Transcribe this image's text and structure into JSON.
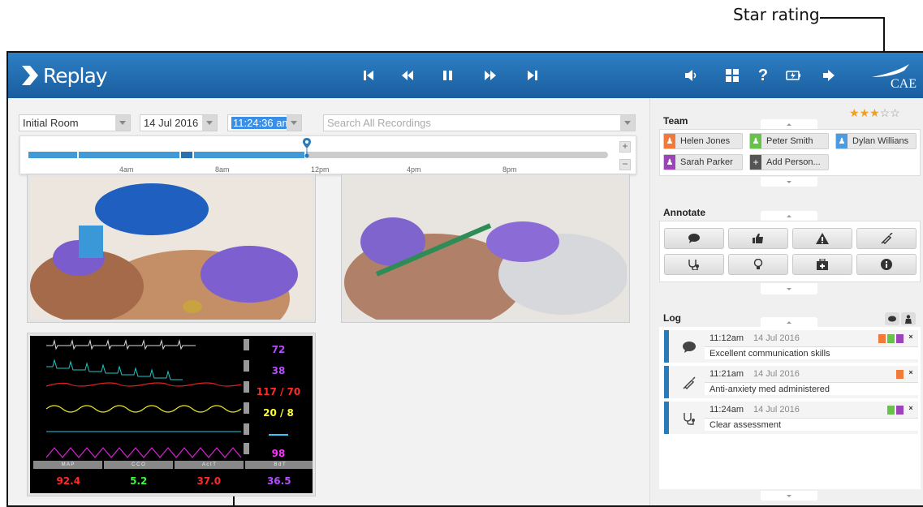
{
  "callout": {
    "star_rating": "Star rating"
  },
  "app": {
    "title": "Replay",
    "brand": "CAE",
    "accent": "#1f6fb2"
  },
  "filters": {
    "room": "Initial Room",
    "date": "14 Jul 2016",
    "time": "11:24:36 am",
    "search_placeholder": "Search All Recordings"
  },
  "timeline": {
    "ticks": [
      "4am",
      "8am",
      "12pm",
      "4pm",
      "8pm"
    ],
    "position_fraction": 0.48,
    "zoom_in": "+",
    "zoom_out": "−"
  },
  "monitor": {
    "values": [
      "72",
      "38",
      "117 / 70",
      "20 / 8",
      "",
      "98"
    ],
    "value_colors": [
      "#b44cff",
      "#b44cff",
      "#ff2a2a",
      "#ffff33",
      "#33c8ff",
      "#ff33ff"
    ],
    "labels": [
      "M A P",
      "C C O",
      "A c t T",
      "B d T"
    ],
    "bottom": [
      "92.4",
      "5.2",
      "37.0",
      "36.5"
    ],
    "bottom_colors": [
      "#ff2a2a",
      "#33ff33",
      "#ff2a2a",
      "#b44cff"
    ]
  },
  "rating": {
    "value": 3,
    "max": 5
  },
  "team": {
    "heading": "Team",
    "members": [
      {
        "name": "Helen Jones",
        "color": "#f07a3a"
      },
      {
        "name": "Peter Smith",
        "color": "#68c24a"
      },
      {
        "name": "Dylan Willians",
        "color": "#4a9be0"
      },
      {
        "name": "Sarah Parker",
        "color": "#9b44b8"
      }
    ],
    "add_label": "Add Person..."
  },
  "annotate": {
    "heading": "Annotate"
  },
  "log": {
    "heading": "Log",
    "entries": [
      {
        "time": "11:12am",
        "date": "14 Jul 2016",
        "message": "Excellent communication skills",
        "icon": "speech-icon"
      },
      {
        "time": "11:21am",
        "date": "14 Jul 2016",
        "message": "Anti-anxiety med administered",
        "icon": "syringe-icon"
      },
      {
        "time": "11:24am",
        "date": "14 Jul 2016",
        "message": "Clear assessment",
        "icon": "stethoscope-icon"
      }
    ]
  }
}
